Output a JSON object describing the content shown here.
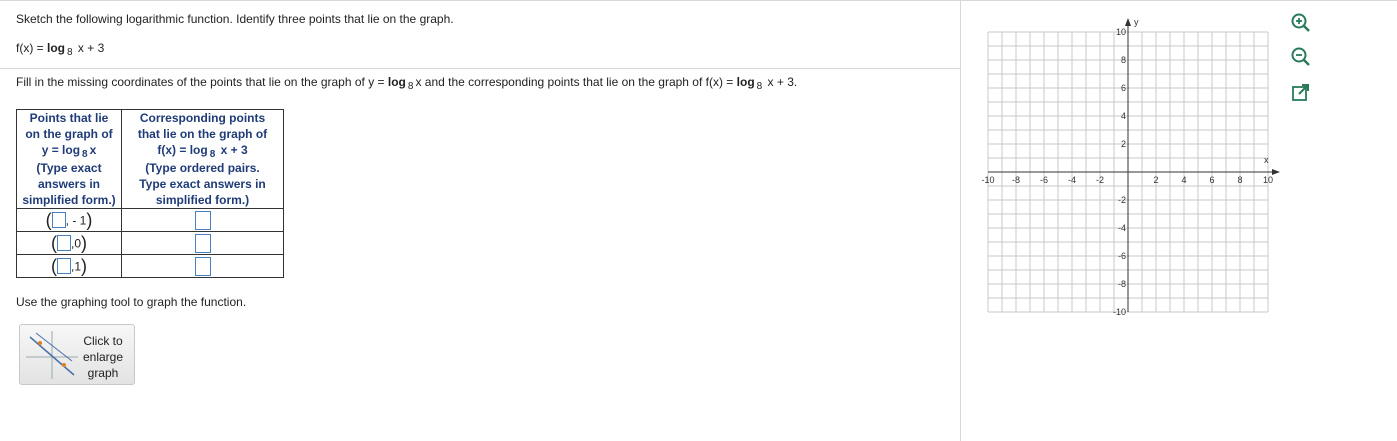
{
  "question": {
    "instruction": "Sketch the following logarithmic function. Identify three points that lie on the graph.",
    "function_prefix": "f(x) = ",
    "function_log": "log",
    "function_base": "8",
    "function_suffix": " x + 3",
    "fill_prefix": "Fill in the missing coordinates of the points that lie on the graph of y = ",
    "fill_log1": "log",
    "fill_base1": "8",
    "fill_mid": "x and the corresponding points that lie on the graph of f(x) = ",
    "fill_log2": "log",
    "fill_base2": "8",
    "fill_suffix": " x + 3."
  },
  "table": {
    "col1_header_l1": "Points that lie",
    "col1_header_l2": "on the graph of",
    "col1_header_eq_prefix": "y = log",
    "col1_header_eq_base": "8",
    "col1_header_eq_suffix": "x",
    "col1_header_hint_l1": "(Type exact",
    "col1_header_hint_l2": "answers in",
    "col1_header_hint_l3": "simplified form.)",
    "col2_header_l1": "Corresponding points",
    "col2_header_l2": "that lie on the graph of",
    "col2_header_eq_prefix": "f(x) = log",
    "col2_header_eq_base": "8",
    "col2_header_eq_suffix": " x + 3",
    "col2_header_hint_l1": "(Type ordered pairs.",
    "col2_header_hint_l2": "Type exact answers in",
    "col2_header_hint_l3": "simplified form.)",
    "rows": [
      {
        "y": " - 1"
      },
      {
        "y": "0"
      },
      {
        "y": "1"
      }
    ]
  },
  "use_tool_text": "Use the graphing tool to graph the function.",
  "enlarge_button_label": "Click to\nenlarge\ngraph",
  "graph": {
    "x_axis_label": "x",
    "y_axis_label": "y",
    "x_tick_labels": [
      "-10",
      "-8",
      "-6",
      "-4",
      "-2",
      "2",
      "4",
      "6",
      "8",
      "10"
    ],
    "y_tick_labels": [
      "10",
      "8",
      "6",
      "4",
      "2",
      "-2",
      "-4",
      "-6",
      "-8",
      "-10"
    ],
    "x_range": [
      -10,
      10
    ],
    "y_range": [
      -10,
      10
    ],
    "grid": true
  },
  "tools": [
    {
      "name": "zoom-in-icon"
    },
    {
      "name": "zoom-out-icon"
    },
    {
      "name": "open-external-icon"
    }
  ],
  "colors": {
    "accent": "#1f3b78",
    "input_border": "#4a7fc0",
    "tool_icon": "#2a7a5a"
  }
}
